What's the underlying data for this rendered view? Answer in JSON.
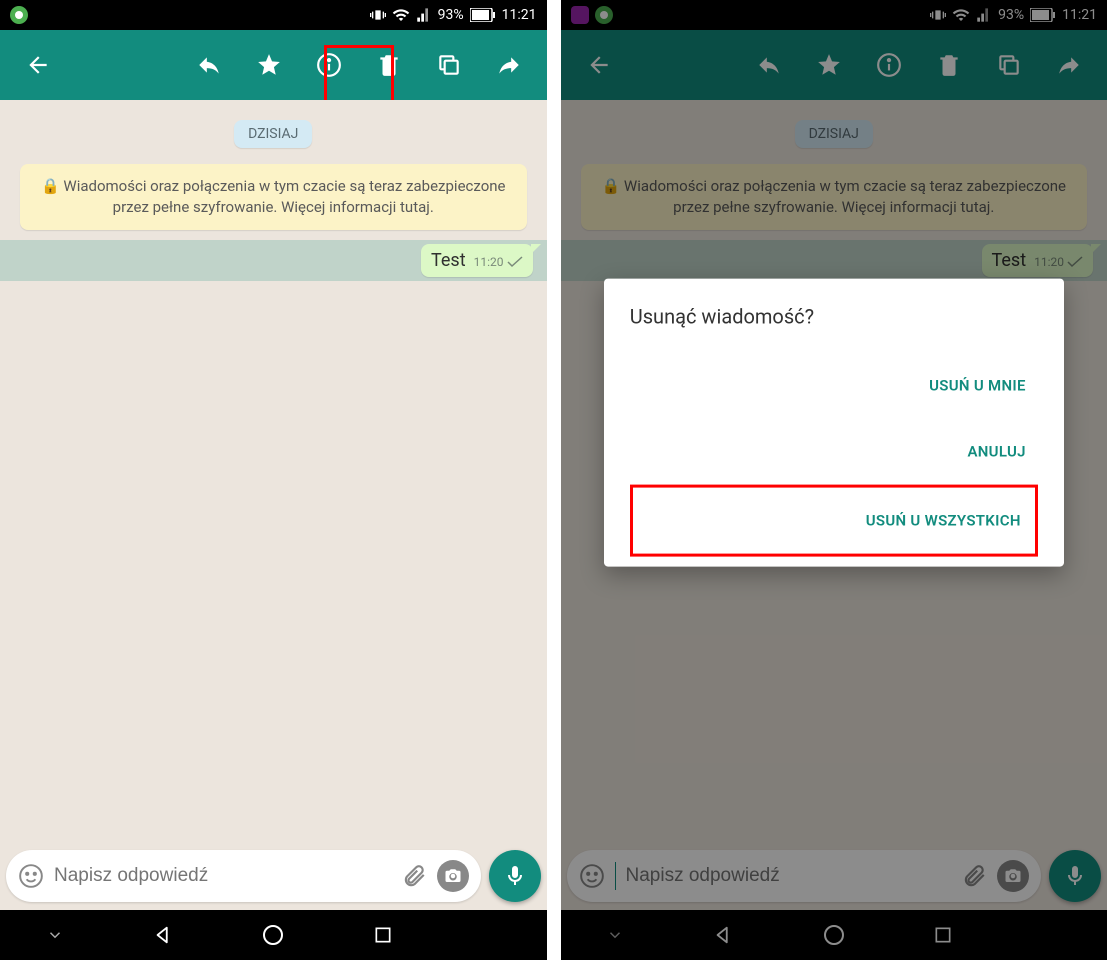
{
  "status": {
    "time": "11:21",
    "battery_text": "93%"
  },
  "chat": {
    "date_chip": "DZISIAJ",
    "encryption_notice": "🔒 Wiadomości oraz połączenia w tym czacie są teraz zabezpieczone przez pełne szyfrowanie. Więcej informacji tutaj.",
    "message": {
      "text": "Test",
      "time": "11:20"
    }
  },
  "input": {
    "placeholder": "Napisz odpowiedź"
  },
  "dialog": {
    "title": "Usunąć wiadomość?",
    "delete_for_me": "USUŃ U MNIE",
    "cancel": "ANULUJ",
    "delete_for_all": "USUŃ U WSZYSTKICH"
  }
}
